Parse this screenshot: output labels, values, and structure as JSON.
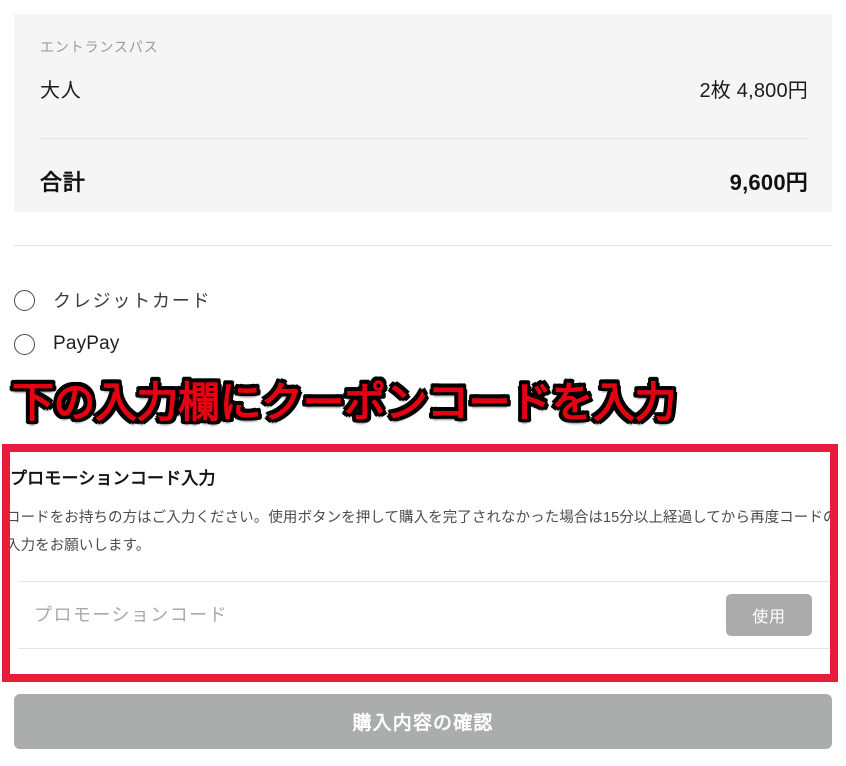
{
  "order_summary": {
    "category_label": "エントランスパス",
    "items": [
      {
        "name": "大人",
        "price": "2枚 4,800円"
      }
    ],
    "total_label": "合計",
    "total_value": "9,600円"
  },
  "payment": {
    "options": [
      {
        "label": "クレジットカード",
        "selected": false
      },
      {
        "label": "PayPay",
        "selected": false
      }
    ]
  },
  "annotation": {
    "text": "下の入力欄にクーポンコードを入力",
    "color": "#e60012",
    "outline_color": "#000000"
  },
  "promotion": {
    "title": "プロモーションコード入力",
    "description": "コードをお持ちの方はご入力ください。使用ボタンを押して購入を完了されなかった場合は15分以上経過してから再度コードの入力をお願いします。",
    "input_value": "",
    "input_placeholder": "プロモーションコード",
    "apply_label": "使用",
    "highlight_color": "#ea1c3d"
  },
  "footer": {
    "confirm_label": "購入内容の確認",
    "confirm_color": "#abacac"
  }
}
